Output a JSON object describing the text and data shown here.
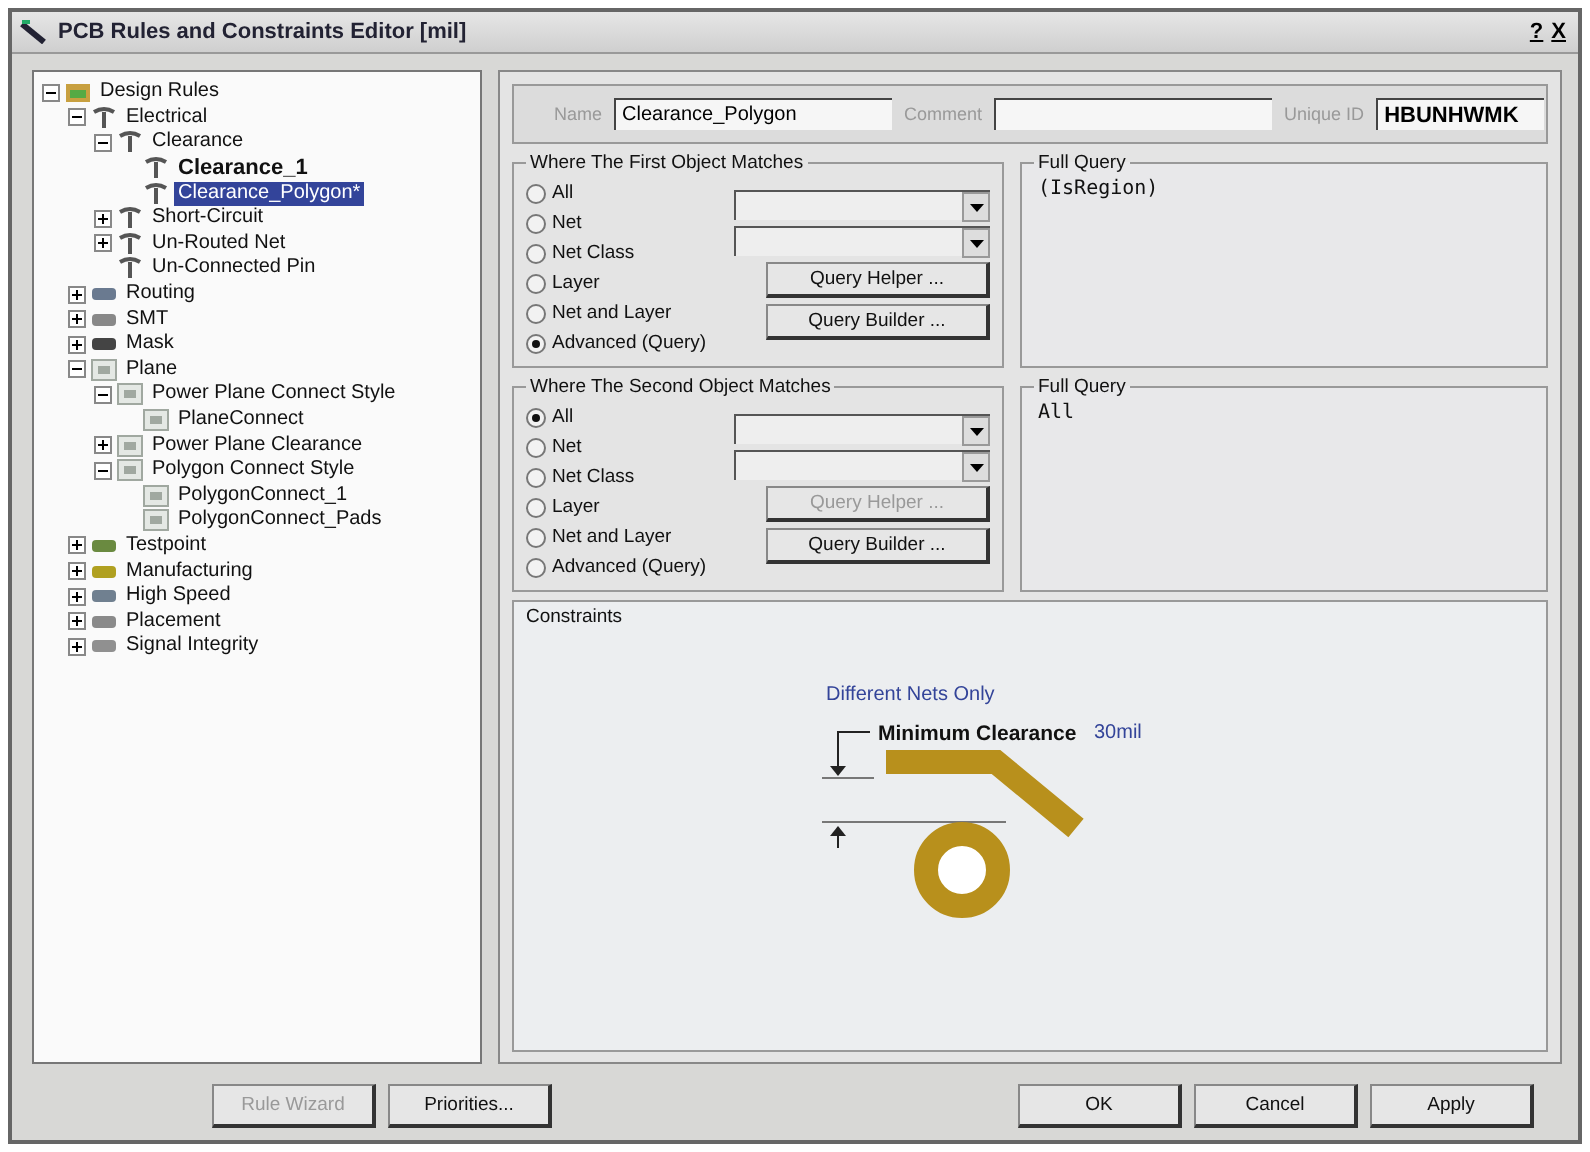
{
  "window": {
    "title": "PCB Rules and Constraints Editor [mil]",
    "help": "?",
    "close": "X"
  },
  "tree": [
    {
      "label": "Design Rules",
      "kind": "folder",
      "expanded": true,
      "selected": false,
      "children": [
        {
          "label": "Electrical",
          "kind": "electrical",
          "expanded": true,
          "selected": false,
          "children": [
            {
              "label": "Clearance",
              "kind": "electrical",
              "expanded": true,
              "selected": false,
              "children": [
                {
                  "label": "Clearance_1",
                  "kind": "electrical",
                  "bold": true,
                  "selected": false
                },
                {
                  "label": "Clearance_Polygon*",
                  "kind": "electrical",
                  "bold": false,
                  "selected": true
                }
              ]
            },
            {
              "label": "Short-Circuit",
              "kind": "electrical",
              "expanded": false,
              "selected": false
            },
            {
              "label": "Un-Routed Net",
              "kind": "electrical",
              "expanded": false,
              "selected": false
            },
            {
              "label": "Un-Connected Pin",
              "kind": "electrical",
              "selected": false
            }
          ]
        },
        {
          "label": "Routing",
          "kind": "routing",
          "expanded": false,
          "selected": false
        },
        {
          "label": "SMT",
          "kind": "smt",
          "expanded": false,
          "selected": false
        },
        {
          "label": "Mask",
          "kind": "mask",
          "expanded": false,
          "selected": false
        },
        {
          "label": "Plane",
          "kind": "plane",
          "expanded": true,
          "selected": false,
          "children": [
            {
              "label": "Power Plane Connect Style",
              "kind": "plane",
              "expanded": true,
              "selected": false,
              "children": [
                {
                  "label": "PlaneConnect",
                  "kind": "plane",
                  "selected": false
                }
              ]
            },
            {
              "label": "Power Plane Clearance",
              "kind": "plane",
              "expanded": false,
              "selected": false
            },
            {
              "label": "Polygon Connect Style",
              "kind": "plane",
              "expanded": true,
              "selected": false,
              "children": [
                {
                  "label": "PolygonConnect_1",
                  "kind": "plane",
                  "selected": false
                },
                {
                  "label": "PolygonConnect_Pads",
                  "kind": "plane",
                  "selected": false
                }
              ]
            }
          ]
        },
        {
          "label": "Testpoint",
          "kind": "testpoint",
          "expanded": false,
          "selected": false
        },
        {
          "label": "Manufacturing",
          "kind": "manufacturing",
          "expanded": false,
          "selected": false
        },
        {
          "label": "High Speed",
          "kind": "highspeed",
          "expanded": false,
          "selected": false
        },
        {
          "label": "Placement",
          "kind": "placement",
          "expanded": false,
          "selected": false
        },
        {
          "label": "Signal Integrity",
          "kind": "signal",
          "expanded": false,
          "selected": false
        }
      ]
    }
  ],
  "rule": {
    "name_label": "Name",
    "name": "Clearance_Polygon",
    "comment_label": "Comment",
    "unique_id_label": "Unique ID",
    "unique_id": "HBUNHWMK"
  },
  "matches": [
    {
      "title": "Where The First Object Matches",
      "options": [
        {
          "label": "All",
          "selected": false
        },
        {
          "label": "Net",
          "selected": false
        },
        {
          "label": "Net Class",
          "selected": false
        },
        {
          "label": "Layer",
          "selected": false
        },
        {
          "label": "Net and Layer",
          "selected": false
        },
        {
          "label": "Advanced (Query)",
          "selected": true
        }
      ],
      "buttons": [
        {
          "label": "Query Helper ...",
          "disabled": false
        },
        {
          "label": "Query Builder ...",
          "disabled": false
        }
      ],
      "query_title": "Full Query",
      "query": "(IsRegion)"
    },
    {
      "title": "Where The Second Object Matches",
      "options": [
        {
          "label": "All",
          "selected": true
        },
        {
          "label": "Net",
          "selected": false
        },
        {
          "label": "Net Class",
          "selected": false
        },
        {
          "label": "Layer",
          "selected": false
        },
        {
          "label": "Net and Layer",
          "selected": false
        },
        {
          "label": "Advanced (Query)",
          "selected": false
        }
      ],
      "buttons": [
        {
          "label": "Query Helper ...",
          "disabled": true
        },
        {
          "label": "Query Builder ...",
          "disabled": false
        }
      ],
      "query_title": "Full Query",
      "query": "All"
    }
  ],
  "constraints": {
    "title": "Constraints",
    "scope": "Different Nets Only",
    "label": "Minimum Clearance",
    "value": "30mil"
  },
  "footer": {
    "left": [
      {
        "label": "Rule Wizard",
        "disabled": true
      },
      {
        "label": "Priorities...",
        "disabled": false
      }
    ],
    "right": [
      {
        "label": "OK",
        "disabled": false
      },
      {
        "label": "Cancel",
        "disabled": false
      },
      {
        "label": "Apply",
        "disabled": false
      }
    ]
  }
}
